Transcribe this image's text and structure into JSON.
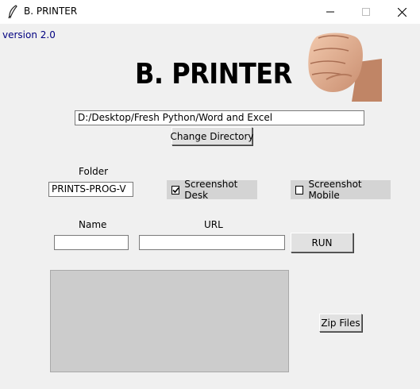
{
  "window": {
    "title": "B. PRINTER",
    "controls": {
      "minimize": "minimize-icon",
      "maximize": "maximize-icon",
      "close": "close-icon"
    }
  },
  "version": "version 2.0",
  "brand": {
    "title": "B. PRINTER",
    "logo": "fist-icon"
  },
  "directory": {
    "path": "D:/Desktop/Fresh Python/Word and Excel",
    "change_button": "Change Directory"
  },
  "folder": {
    "label": "Folder",
    "value": "PRINTS-PROG-V"
  },
  "options": {
    "screenshot_desk": {
      "label": "Screenshot Desk",
      "checked": true
    },
    "screenshot_mobile": {
      "label": "Screenshot Mobile",
      "checked": false
    }
  },
  "name": {
    "label": "Name",
    "value": ""
  },
  "url": {
    "label": "URL",
    "value": ""
  },
  "run_button": "RUN",
  "zip_button": "Zip Files",
  "colors": {
    "version_text": "#000080",
    "checkbox_bg": "#d4d4d4",
    "listbox_bg": "#cccccc"
  }
}
